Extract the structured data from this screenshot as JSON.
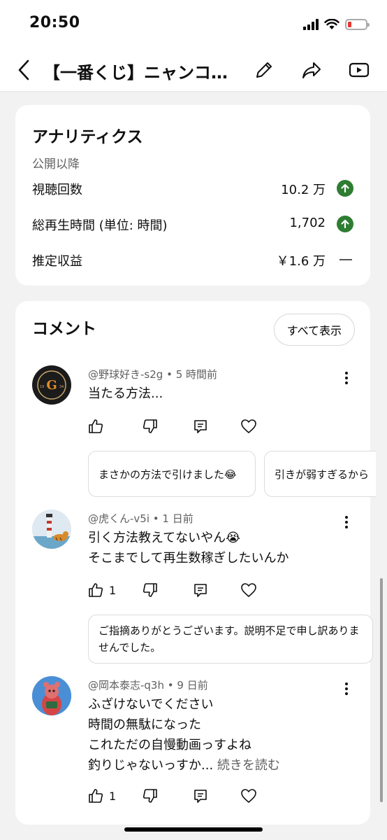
{
  "status_bar": {
    "time": "20:50",
    "battery_color": "#e53935"
  },
  "header": {
    "title": "【一番くじ】ニャンコ…",
    "icons": [
      "back-icon",
      "edit-pencil-icon",
      "share-icon",
      "youtube-icon"
    ]
  },
  "analytics": {
    "title": "アナリティクス",
    "subtitle": "公開以降",
    "metrics": [
      {
        "label": "視聴回数",
        "value": "10.2 万",
        "trend": "up"
      },
      {
        "label": "総再生時間 (単位: 時間)",
        "value": "1,702",
        "trend": "up"
      },
      {
        "label": "推定収益",
        "value": "￥1.6 万",
        "trend": "flat"
      }
    ],
    "trend_up_color": "#2e7d32"
  },
  "comments": {
    "title": "コメント",
    "show_all_label": "すべて表示",
    "items": [
      {
        "author": "@野球好き-s2g",
        "time": "5 時間前",
        "lines": [
          "当たる方法..."
        ],
        "like_count": "",
        "avatar_text": "G",
        "avatar_sub": [
          "19",
          "34"
        ],
        "replies": [
          "まさかの方法で引けました😂",
          "引きが弱すぎるから"
        ]
      },
      {
        "author": "@虎くん-v5i",
        "time": "1 日前",
        "lines": [
          "引く方法教えてないやん😭",
          "そこまでして再生数稼ぎしたいんか"
        ],
        "like_count": "1",
        "replies": [
          "ご指摘ありがとうございます。説明不足で申し訳ありませんでした。"
        ]
      },
      {
        "author": "@岡本泰志-q3h",
        "time": "9 日前",
        "lines": [
          "ふざけないでください",
          "時間の無駄になった",
          "これただの自慢動画っすよね",
          "釣りじゃないっすか..."
        ],
        "read_more": "続きを読む",
        "like_count": "1"
      }
    ]
  }
}
